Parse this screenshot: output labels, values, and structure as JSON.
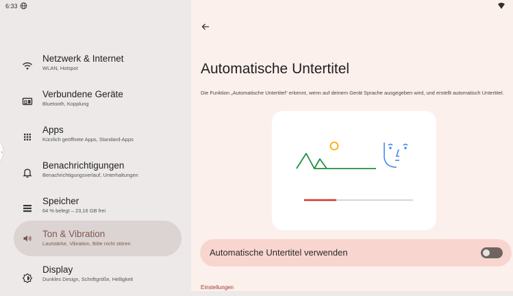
{
  "status_bar": {
    "time": "6:33",
    "icons": [
      "globe-icon",
      "wifi-icon"
    ]
  },
  "sidebar": {
    "items": [
      {
        "title": "Netzwerk & Internet",
        "subtitle": "WLAN, Hotspot",
        "icon": "wifi-icon",
        "active": false
      },
      {
        "title": "Verbundene Geräte",
        "subtitle": "Bluetooth, Kopplung",
        "icon": "connected-devices-icon",
        "active": false
      },
      {
        "title": "Apps",
        "subtitle": "Kürzlich geöffnete Apps, Standard-Apps",
        "icon": "apps-grid-icon",
        "active": false
      },
      {
        "title": "Benachrichtigungen",
        "subtitle": "Benachrichtigungsverlauf, Unterhaltungen",
        "icon": "bell-icon",
        "active": false
      },
      {
        "title": "Speicher",
        "subtitle": "64 % belegt – 23,16 GB frei",
        "icon": "storage-icon",
        "active": false
      },
      {
        "title": "Ton & Vibration",
        "subtitle": "Lautstärke, Vibration, Bitte nicht stören",
        "icon": "volume-icon",
        "active": true
      },
      {
        "title": "Display",
        "subtitle": "Dunkles Design, Schriftgröße, Helligkeit",
        "icon": "display-brightness-icon",
        "active": false
      }
    ]
  },
  "main": {
    "title": "Automatische Untertitel",
    "description": "Die Funktion „Automatische Untertitel“ erkennt, wenn auf deinem Gerät Sprache ausgegeben wird, und erstellt automatisch Untertitel.",
    "toggle_label": "Automatische Untertitel verwenden",
    "toggle_on": false,
    "section_label": "Einstellungen"
  },
  "colors": {
    "sidebar_bg": "#ece9e8",
    "active_item_bg": "#dcd4d2",
    "active_text": "#7d5a51",
    "main_bg": "#fcf0ec",
    "toggle_row_bg": "#f8d6cf",
    "accent": "#9b3a2c",
    "illus_green": "#1e8e3e",
    "illus_yellow": "#f9ab00",
    "illus_blue": "#4285f4",
    "illus_red": "#d93025"
  }
}
